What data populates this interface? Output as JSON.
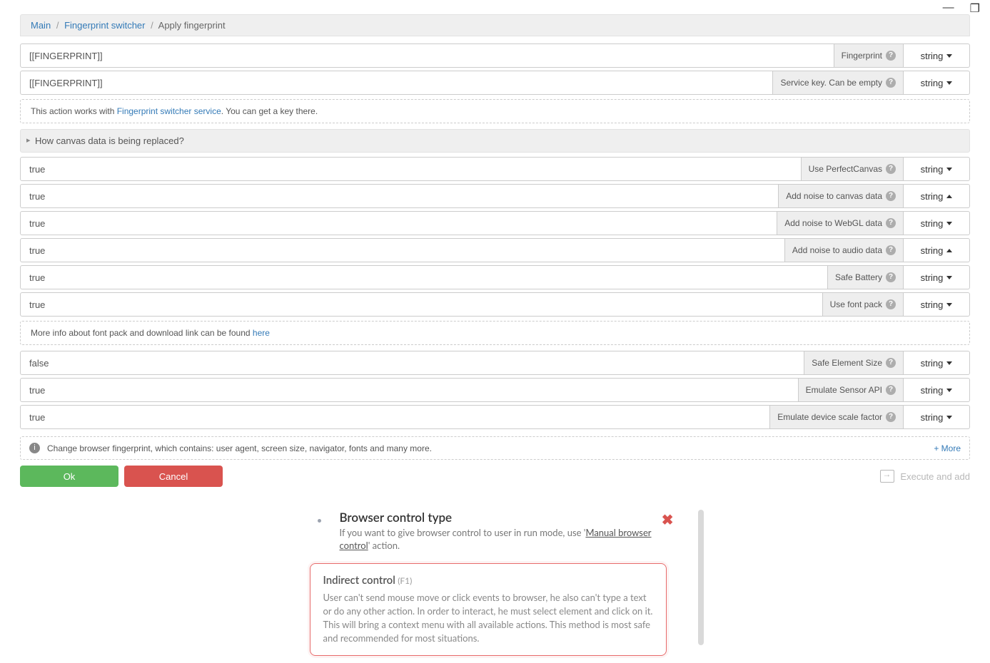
{
  "window_controls": {
    "minimize": "—",
    "maximize": "❐"
  },
  "breadcrumb": {
    "items": [
      "Main",
      "Fingerprint switcher"
    ],
    "current": "Apply fingerprint"
  },
  "note_service": {
    "before": "This action works with ",
    "link": "Fingerprint switcher service",
    "after": ". You can get a key there."
  },
  "section_canvas": "How canvas data is being replaced?",
  "note_font": {
    "before": "More info about font pack and download link can be found ",
    "link": "here"
  },
  "rows": [
    {
      "value": "[[FINGERPRINT]]",
      "label": "Fingerprint",
      "type": "string",
      "arrow": "down"
    },
    {
      "value": "[[FINGERPRINT]]",
      "label": "Service key. Can be empty",
      "type": "string",
      "arrow": "down"
    },
    {
      "value": "true",
      "label": "Use PerfectCanvas",
      "type": "string",
      "arrow": "down"
    },
    {
      "value": "true",
      "label": "Add noise to canvas data",
      "type": "string",
      "arrow": "up"
    },
    {
      "value": "true",
      "label": "Add noise to WebGL data",
      "type": "string",
      "arrow": "down"
    },
    {
      "value": "true",
      "label": "Add noise to audio data",
      "type": "string",
      "arrow": "up"
    },
    {
      "value": "true",
      "label": "Safe Battery",
      "type": "string",
      "arrow": "down"
    },
    {
      "value": "true",
      "label": "Use font pack",
      "type": "string",
      "arrow": "down"
    },
    {
      "value": "false",
      "label": "Safe Element Size",
      "type": "string",
      "arrow": "down"
    },
    {
      "value": "true",
      "label": "Emulate Sensor API",
      "type": "string",
      "arrow": "down"
    },
    {
      "value": "true",
      "label": "Emulate device scale factor",
      "type": "string",
      "arrow": "down"
    }
  ],
  "footer": {
    "text": "Change browser fingerprint, which contains: user agent, screen size, navigator, fonts and many more.",
    "more": "+ More"
  },
  "buttons": {
    "ok": "Ok",
    "cancel": "Cancel",
    "execute": "Execute and add"
  },
  "popup": {
    "title": "Browser control type",
    "subtitle_before": "If you want to give browser control to user in run mode, use '",
    "subtitle_link": "Manual browser control",
    "subtitle_after": "' action.",
    "card": {
      "title": "Indirect control",
      "key": "(F1)",
      "body": "User can't send mouse move or click events to browser, he also can't type a text or do any other action. In order to interact, he must select element and click on it. This will bring a context menu with all available actions. This method is most safe and recommended for most situations."
    }
  }
}
